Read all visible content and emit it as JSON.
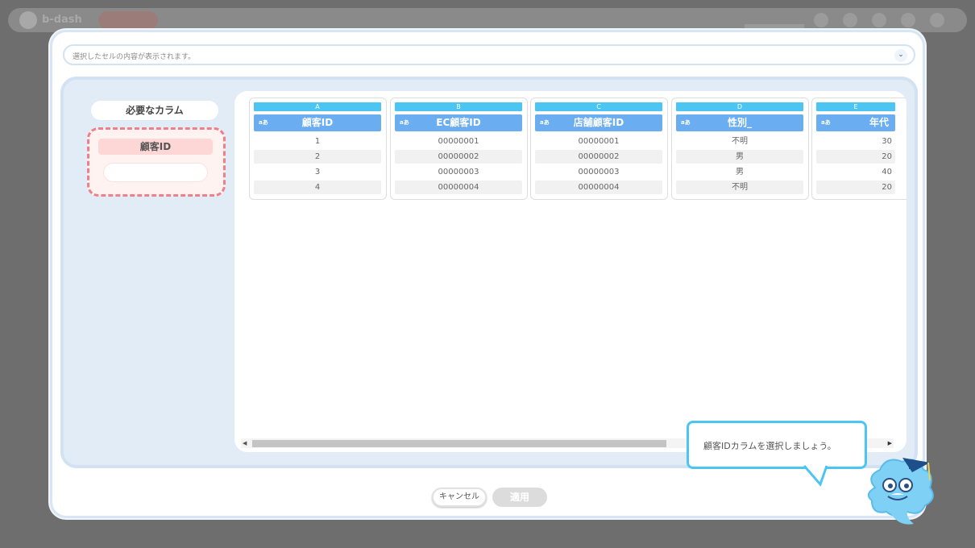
{
  "background": {
    "logo_text": "b-dash"
  },
  "cell_bar": {
    "placeholder": "選択したセルの内容が表示されます。",
    "chevron": "⌄"
  },
  "left_panel": {
    "title": "必要なカラム",
    "required": [
      {
        "label": "顧客ID"
      }
    ]
  },
  "columns": [
    {
      "letter": "A",
      "type": "aあ",
      "name": "顧客ID",
      "rows": [
        "1",
        "2",
        "3",
        "4"
      ]
    },
    {
      "letter": "B",
      "type": "aあ",
      "name": "EC顧客ID",
      "rows": [
        "00000001",
        "00000002",
        "00000003",
        "00000004"
      ]
    },
    {
      "letter": "C",
      "type": "aあ",
      "name": "店舗顧客ID",
      "rows": [
        "00000001",
        "00000002",
        "00000003",
        "00000004"
      ]
    },
    {
      "letter": "D",
      "type": "aあ",
      "name": "性別_",
      "rows": [
        "不明",
        "男",
        "男",
        "不明"
      ]
    },
    {
      "letter": "E",
      "type": "aあ",
      "name": "年代",
      "rows": [
        "30",
        "20",
        "40",
        "20"
      ]
    }
  ],
  "buttons": {
    "cancel": "キャンセル",
    "apply": "適用"
  },
  "guide": {
    "message": "顧客IDカラムを選択しましょう。"
  },
  "colors": {
    "accent": "#4cc5f2",
    "header": "#6aaef1",
    "dashed": "#ef7f88"
  }
}
